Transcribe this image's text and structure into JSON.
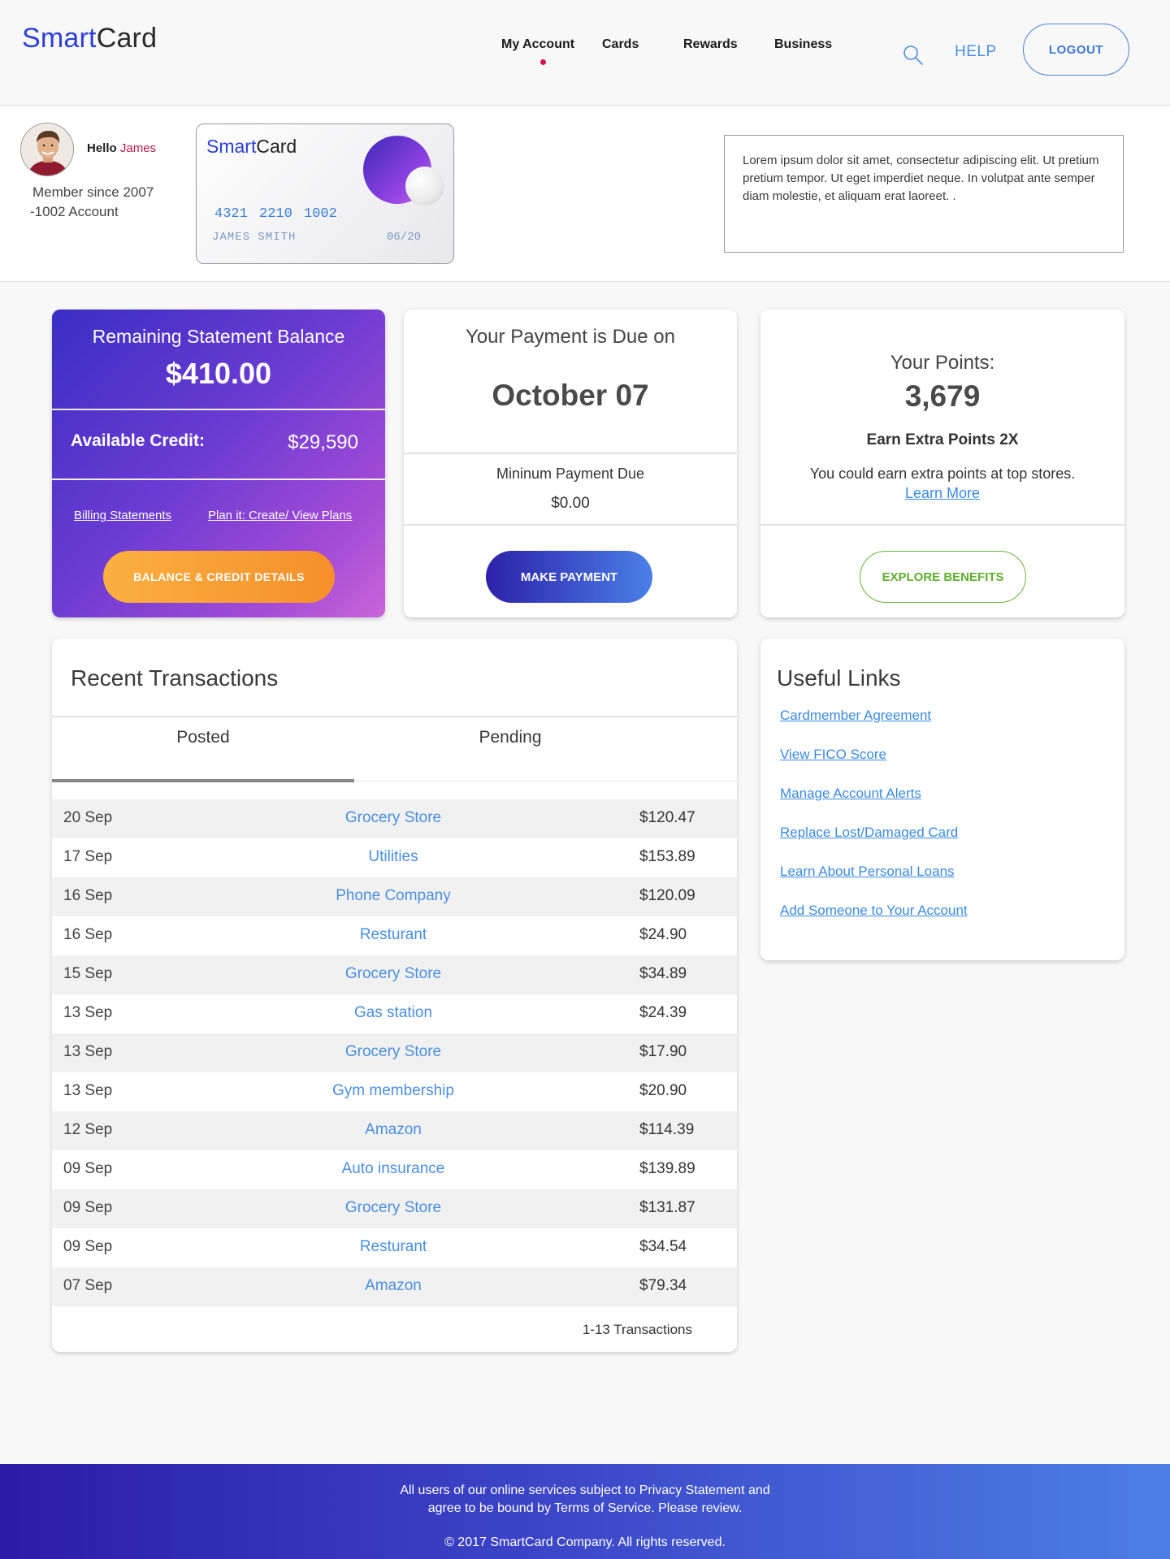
{
  "brand": {
    "logo_part1": "Smart",
    "logo_part2": "Card"
  },
  "nav": {
    "items": [
      "My Account",
      "Cards",
      "Rewards",
      "Business"
    ],
    "help": "HELP",
    "logout": "LOGOUT"
  },
  "profile": {
    "greeting": "Hello",
    "name": "James",
    "member_since": "Member since 2007",
    "account": "-1002 Account"
  },
  "card": {
    "logo_part1": "Smart",
    "logo_part2": "Card",
    "number": "4321 2210 1002",
    "holder": "JAMES SMITH",
    "expiry": "06/20"
  },
  "notice": "Lorem ipsum dolor sit amet, consectetur adipiscing elit. Ut pretium pretium tempor. Ut eget imperdiet neque. In volutpat ante semper diam molestie, et aliquam erat laoreet. .",
  "balance": {
    "label": "Remaining Statement Balance",
    "amount": "$410.00",
    "credit_label": "Available Credit:",
    "credit_value": "$29,590",
    "link_billing": "Billing Statements",
    "link_plan": "Plan it: Create/ View Plans",
    "button": "BALANCE & CREDIT DETAILS"
  },
  "payment": {
    "title": "Your Payment is Due on",
    "date": "October 07",
    "min_label": "Mininum Payment Due",
    "min_value": "$0.00",
    "button": "MAKE PAYMENT"
  },
  "points": {
    "label": "Your Points:",
    "value": "3,679",
    "earn_title": "Earn Extra Points 2X",
    "earn_text": "You could earn extra points at top stores.",
    "learn_more": "Learn More",
    "button": "EXPLORE BENEFITS"
  },
  "transactions": {
    "title": "Recent Transactions",
    "tabs": [
      "Posted",
      "Pending"
    ],
    "rows": [
      {
        "date": "20 Sep",
        "merchant": "Grocery Store",
        "amount": "$120.47"
      },
      {
        "date": "17 Sep",
        "merchant": "Utilities",
        "amount": "$153.89"
      },
      {
        "date": "16 Sep",
        "merchant": "Phone Company",
        "amount": "$120.09"
      },
      {
        "date": "16 Sep",
        "merchant": "Resturant",
        "amount": "$24.90"
      },
      {
        "date": "15 Sep",
        "merchant": "Grocery Store",
        "amount": "$34.89"
      },
      {
        "date": "13 Sep",
        "merchant": "Gas station",
        "amount": "$24.39"
      },
      {
        "date": "13 Sep",
        "merchant": "Grocery Store",
        "amount": "$17.90"
      },
      {
        "date": "13 Sep",
        "merchant": "Gym membership",
        "amount": "$20.90"
      },
      {
        "date": "12 Sep",
        "merchant": "Amazon",
        "amount": "$114.39"
      },
      {
        "date": "09 Sep",
        "merchant": "Auto insurance",
        "amount": "$139.89"
      },
      {
        "date": "09 Sep",
        "merchant": "Grocery Store",
        "amount": "$131.87"
      },
      {
        "date": "09 Sep",
        "merchant": "Resturant",
        "amount": "$34.54"
      },
      {
        "date": "07 Sep",
        "merchant": "Amazon",
        "amount": "$79.34"
      }
    ],
    "count": "1-13 Transactions"
  },
  "useful_links": {
    "title": "Useful Links",
    "items": [
      "Cardmember Agreement",
      "View FICO Score",
      "Manage Account Alerts",
      "Replace Lost/Damaged Card",
      "Learn About Personal Loans",
      "Add Someone to Your Account"
    ]
  },
  "footer": {
    "line1": "All users of our online services subject to Privacy Statement and",
    "line2": "agree to be bound by Terms of Service. Please review.",
    "copyright": "© 2017 SmartCard Company. All rights reserved."
  },
  "colors": {
    "brand_blue": "#2b3fd8",
    "accent_link": "#3a8ae0",
    "nav_dot": "#d1174f",
    "balance_gradient_start": "#3a2ec4",
    "balance_gradient_end": "#c866d9",
    "orange_button": "#f5a033",
    "green_button": "#5fae2e"
  },
  "icons": {
    "search": "search-icon",
    "avatar": "avatar"
  }
}
